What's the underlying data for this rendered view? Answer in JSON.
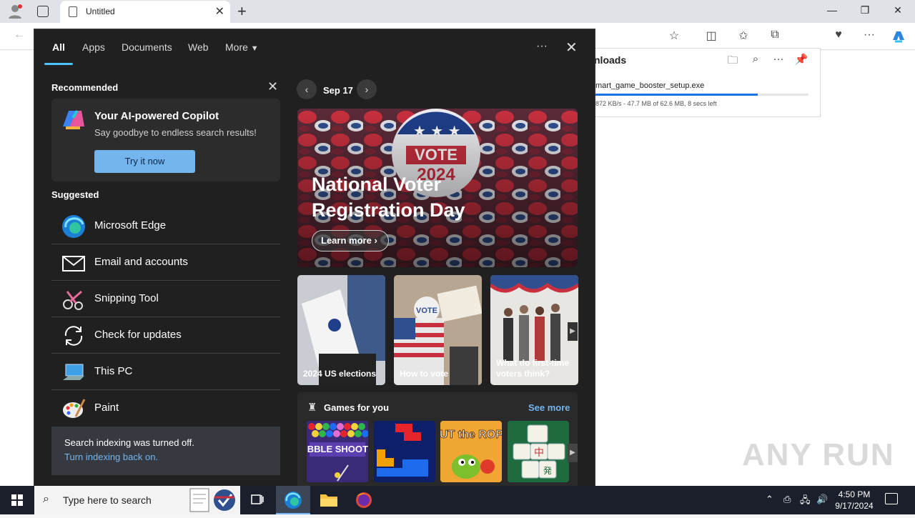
{
  "browser": {
    "tab_title": "Untitled",
    "new_tab": "+",
    "win_min": "—",
    "win_max": "❐",
    "win_close": "✕"
  },
  "downloads": {
    "header": "nloads",
    "file_name": "mart_game_booster_setup.exe",
    "status": "872 KB/s - 47.7 MB of 62.6 MB, 8 secs left",
    "progress_fraction": 0.762
  },
  "search": {
    "tabs": [
      "All",
      "Apps",
      "Documents",
      "Web",
      "More"
    ],
    "more_menu": "···",
    "recommended_label": "Recommended",
    "copilot": {
      "title": "Your AI-powered Copilot",
      "subtitle": "Say goodbye to endless search results!",
      "button": "Try it now"
    },
    "suggested_label": "Suggested",
    "suggested": [
      {
        "label": "Microsoft Edge",
        "icon": "edge-icon"
      },
      {
        "label": "Email and accounts",
        "icon": "mail-icon"
      },
      {
        "label": "Snipping Tool",
        "icon": "snipping-tool-icon"
      },
      {
        "label": "Check for updates",
        "icon": "refresh-icon"
      },
      {
        "label": "This PC",
        "icon": "computer-icon"
      },
      {
        "label": "Paint",
        "icon": "paint-palette-icon"
      }
    ],
    "indexing": {
      "message": "Search indexing was turned off.",
      "link": "Turn indexing back on."
    },
    "date": "Sep 17",
    "hero": {
      "title": "National Voter Registration Day",
      "button": "Learn more",
      "badge_top": "VOTE",
      "badge_bottom": "2024"
    },
    "cards": [
      {
        "caption": "2024 US elections"
      },
      {
        "caption": "How to vote"
      },
      {
        "caption": "What do first-time voters think?"
      }
    ],
    "games": {
      "title": "Games for you",
      "see_more": "See more",
      "tiles": [
        "BUBBLE SHOOTER",
        "Tetris blocks",
        "CUT the ROPE",
        "Mahjong"
      ]
    }
  },
  "watermark": "ANY RUN",
  "taskbar": {
    "search_placeholder": "Type here to search",
    "time": "4:50 PM",
    "date": "9/17/2024"
  },
  "colors": {
    "accent": "#4cc2ff",
    "panel_bg": "#202020",
    "link": "#74b5ee",
    "taskbar": "#1a1f2b"
  }
}
